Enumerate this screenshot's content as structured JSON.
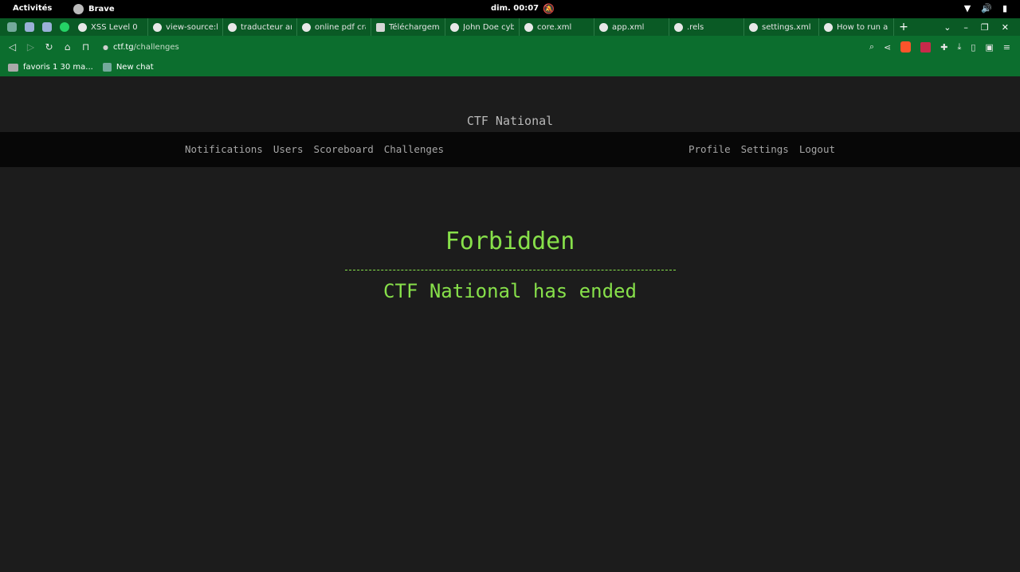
{
  "system": {
    "activities": "Activités",
    "app_name": "Brave",
    "clock": "dim. 00:07"
  },
  "tabs": [
    {
      "label": "XSS Level 0"
    },
    {
      "label": "view-source:h"
    },
    {
      "label": "traducteur an"
    },
    {
      "label": "online pdf cra"
    },
    {
      "label": "Téléchargeme"
    },
    {
      "label": "John Doe cybe"
    },
    {
      "label": "core.xml"
    },
    {
      "label": "app.xml"
    },
    {
      "label": ".rels"
    },
    {
      "label": "settings.xml"
    },
    {
      "label": "How to run a"
    }
  ],
  "address": {
    "host": "ctf.tg",
    "path": "/challenges"
  },
  "bookmarks": [
    {
      "label": "favoris 1 30 ma..."
    },
    {
      "label": "New chat"
    }
  ],
  "site": {
    "title": "CTF National",
    "nav_left": [
      "Notifications",
      "Users",
      "Scoreboard",
      "Challenges"
    ],
    "nav_right": [
      "Profile",
      "Settings",
      "Logout"
    ]
  },
  "message": {
    "heading": "Forbidden",
    "body": "CTF National has ended"
  },
  "colors": {
    "accent": "#87e04a",
    "browser_chrome": "#0c6e2e",
    "page_bg": "#1c1c1c"
  }
}
